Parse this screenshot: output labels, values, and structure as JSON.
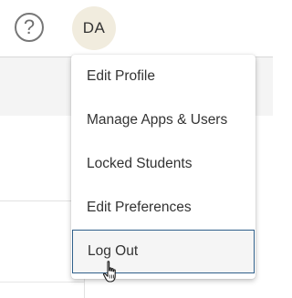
{
  "header": {
    "help_glyph": "?",
    "help_icon": "help-circle-icon",
    "avatar_initials": "DA"
  },
  "account_menu": {
    "items": [
      {
        "label": "Edit Profile"
      },
      {
        "label": "Manage Apps & Users"
      },
      {
        "label": "Locked Students"
      },
      {
        "label": "Edit Preferences"
      },
      {
        "label": "Log Out",
        "state": "hovered"
      }
    ]
  },
  "colors": {
    "avatar_bg": "#f1ecde",
    "hover_border": "#2f5f8a",
    "band_bg": "#f4f4f4"
  }
}
